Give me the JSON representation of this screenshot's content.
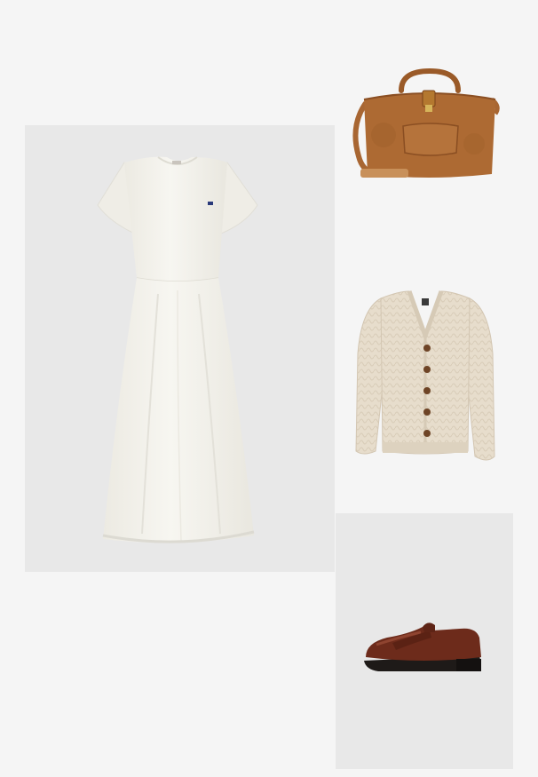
{
  "outfit": {
    "items": [
      {
        "product": "dress",
        "color": "#f3f1ea"
      },
      {
        "product": "bag",
        "color": "#a8652e"
      },
      {
        "product": "cardigan",
        "color": "#e6dccb"
      },
      {
        "product": "loafer",
        "color": "#6a2a1a"
      }
    ],
    "background_color": "#f5f5f5",
    "panel_color": "#e8e8e8"
  }
}
